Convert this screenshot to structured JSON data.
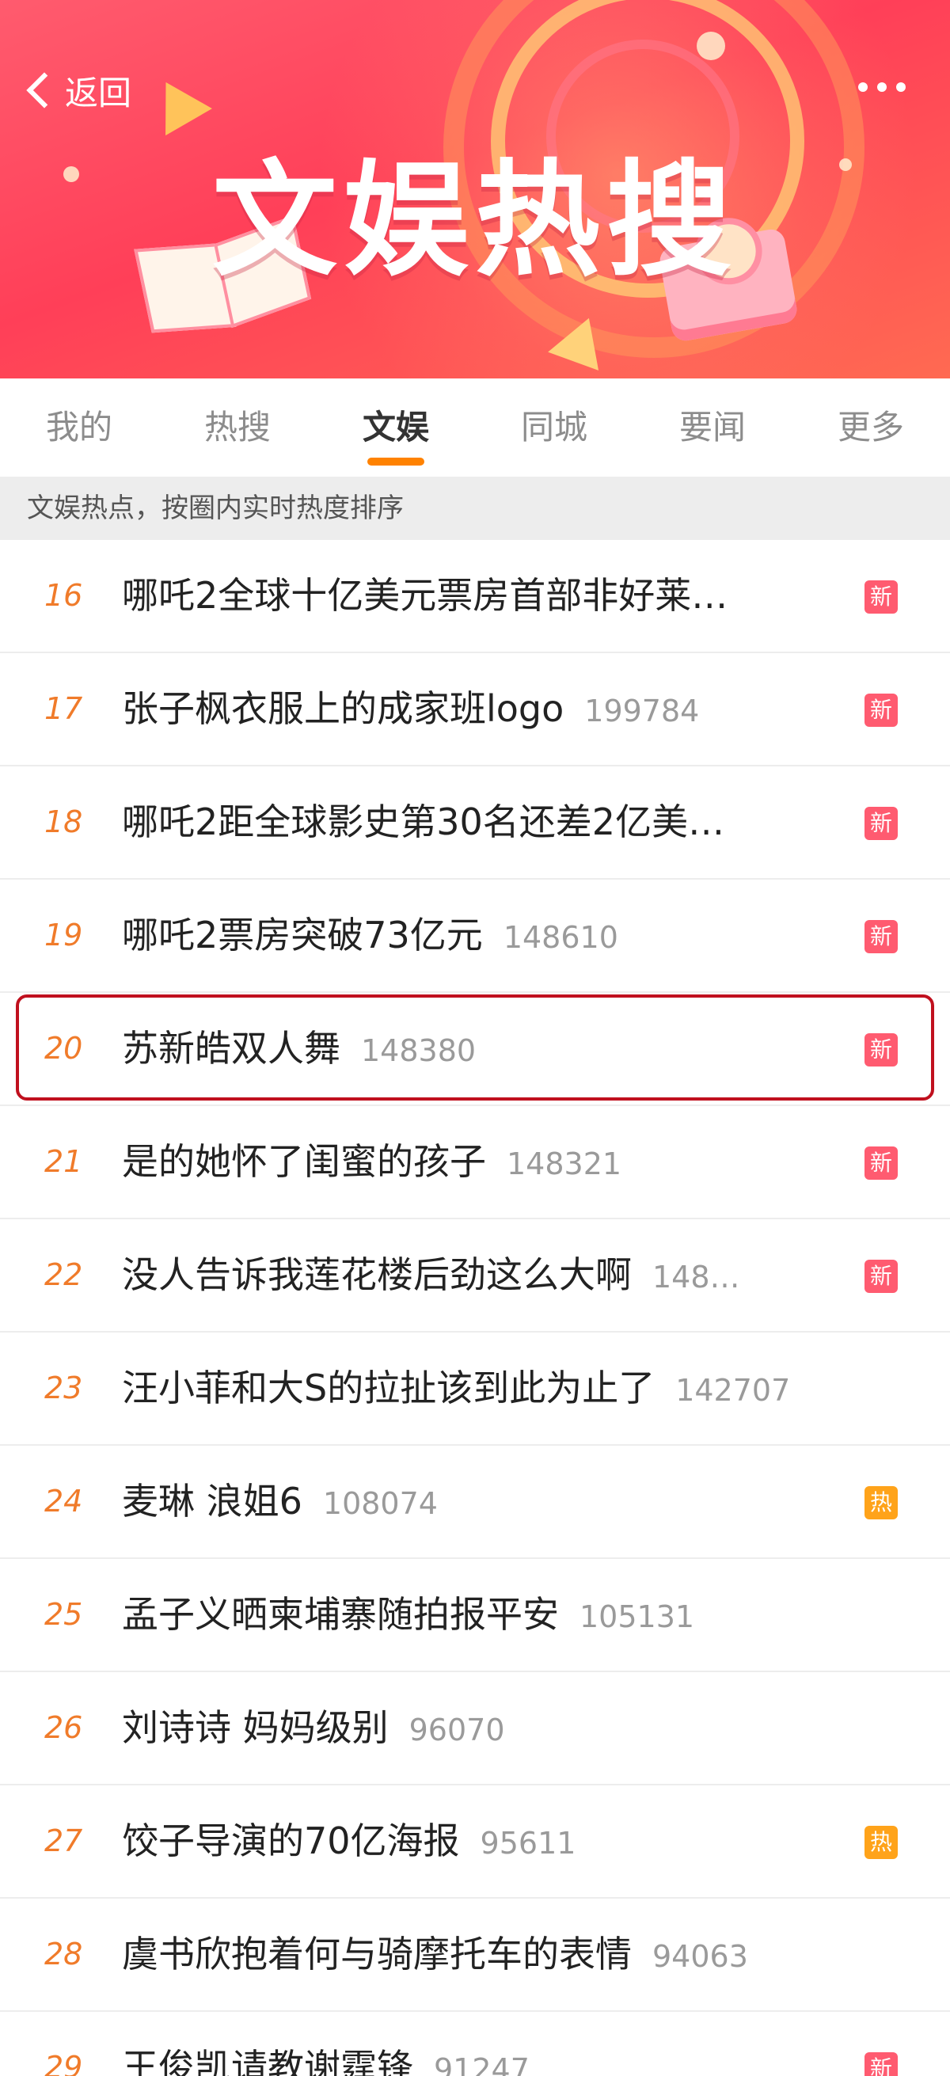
{
  "header": {
    "back_label": "返回",
    "banner_title": "文娱热搜"
  },
  "tabs": [
    {
      "label": "我的",
      "active": false
    },
    {
      "label": "热搜",
      "active": false
    },
    {
      "label": "文娱",
      "active": true
    },
    {
      "label": "同城",
      "active": false
    },
    {
      "label": "要闻",
      "active": false
    },
    {
      "label": "更多",
      "active": false
    }
  ],
  "info_text": "文娱热点，按圈内实时热度排序",
  "list": [
    {
      "rank": "16",
      "title": "哪吒2全球十亿美元票房首部非好莱…",
      "count": "",
      "badge": "新",
      "badge_type": "new"
    },
    {
      "rank": "17",
      "title": "张子枫衣服上的成家班logo",
      "count": "199784",
      "badge": "新",
      "badge_type": "new"
    },
    {
      "rank": "18",
      "title": "哪吒2距全球影史第30名还差2亿美…",
      "count": "",
      "badge": "新",
      "badge_type": "new"
    },
    {
      "rank": "19",
      "title": "哪吒2票房突破73亿元",
      "count": "148610",
      "badge": "新",
      "badge_type": "new"
    },
    {
      "rank": "20",
      "title": "苏新皓双人舞",
      "count": "148380",
      "badge": "新",
      "badge_type": "new",
      "highlighted": true
    },
    {
      "rank": "21",
      "title": "是的她怀了闺蜜的孩子",
      "count": "148321",
      "badge": "新",
      "badge_type": "new"
    },
    {
      "rank": "22",
      "title": "没人告诉我莲花楼后劲这么大啊",
      "count": "148…",
      "badge": "新",
      "badge_type": "new"
    },
    {
      "rank": "23",
      "title": "汪小菲和大S的拉扯该到此为止了",
      "count": "142707",
      "badge": "",
      "badge_type": ""
    },
    {
      "rank": "24",
      "title": "麦琳 浪姐6",
      "count": "108074",
      "badge": "热",
      "badge_type": "hot"
    },
    {
      "rank": "25",
      "title": "孟子义晒柬埔寨随拍报平安",
      "count": "105131",
      "badge": "",
      "badge_type": ""
    },
    {
      "rank": "26",
      "title": "刘诗诗 妈妈级别",
      "count": "96070",
      "badge": "",
      "badge_type": ""
    },
    {
      "rank": "27",
      "title": "饺子导演的70亿海报",
      "count": "95611",
      "badge": "热",
      "badge_type": "hot"
    },
    {
      "rank": "28",
      "title": "虞书欣抱着何与骑摩托车的表情",
      "count": "94063",
      "badge": "",
      "badge_type": ""
    },
    {
      "rank": "29",
      "title": "王俊凯请教谢霆锋",
      "count": "91247",
      "badge": "新",
      "badge_type": "new"
    }
  ],
  "colors": {
    "accent": "#ff8200",
    "rank": "#f07b2a",
    "badge_new": "#ff5b70",
    "badge_hot": "#ffa31a",
    "highlight_border": "#c0101e"
  },
  "icons": {
    "back": "chevron-left-icon",
    "more": "more-dots-icon"
  }
}
